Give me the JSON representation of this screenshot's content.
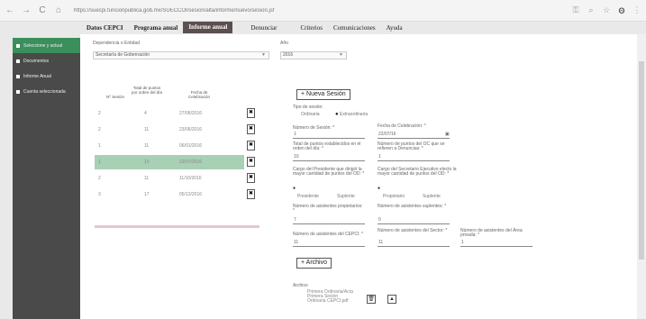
{
  "browser": {
    "back": "←",
    "forward": "→",
    "reload": "C",
    "home": "⌂",
    "url": "https://suecpi.funcionpublica.gob.mx/SUECCOI/sesion/alta/informe/nuevo/sesion.jsf",
    "icons": [
      "key-icon",
      "zoom-icon",
      "star-icon",
      "profile-icon",
      "menu-icon"
    ]
  },
  "sidebar": {
    "items": [
      {
        "label": "Seleccione y actual",
        "active": true
      },
      {
        "label": "Documentos",
        "active": false
      },
      {
        "label": "Informe Anual",
        "active": false
      },
      {
        "label": "Cuenta seleccionada",
        "active": false
      }
    ]
  },
  "menu": {
    "items": [
      {
        "label": "Datos CEPCI",
        "active": false
      },
      {
        "label": "Programa anual",
        "active": false
      },
      {
        "label": "Informe anual",
        "active": true
      },
      {
        "label": "Denunciar",
        "active": false
      },
      {
        "label": "Criterios",
        "active": false
      },
      {
        "label": "Comunicaciones",
        "active": false
      },
      {
        "label": "Ayuda",
        "active": false
      }
    ]
  },
  "filters": {
    "dependency_label": "Dependencia o Entidad",
    "dependency_value": "Secretaría de Gobernación",
    "year_label": "Año",
    "year_value": "2016"
  },
  "table": {
    "headers": [
      "Nº Sesión",
      "Total de puntos por orden del día",
      "Fecha de Celebración"
    ],
    "rows": [
      {
        "session": "2",
        "points": "4",
        "date": "27/06/2016",
        "selected": false
      },
      {
        "session": "2",
        "points": "11",
        "date": "23/06/2016",
        "selected": false
      },
      {
        "session": "1",
        "points": "11",
        "date": "06/01/2016",
        "selected": false
      },
      {
        "session": "1",
        "points": "10",
        "date": "22/07/2016",
        "selected": true
      },
      {
        "session": "2",
        "points": "11",
        "date": "11/10/2016",
        "selected": false
      },
      {
        "session": "3",
        "points": "17",
        "date": "05/12/2016",
        "selected": false
      }
    ],
    "delete_glyph": "✖"
  },
  "form": {
    "new_session_button": "+ Nueva Sesión",
    "session_type_label": "Tipo de sesión:",
    "session_type_options": [
      "Ordinaria",
      "Extraordinaria"
    ],
    "session_number_label": "Número de Sesión: *",
    "session_number_value": "1",
    "date_label": "Fecha de Celebración: *",
    "date_value": "22/07/16",
    "total_points_label": "Total de puntos establecidos en el orden del día: *",
    "total_points_value": "10",
    "cc_points_label": "Número de puntos del OC que se refieren a Denuncias: *",
    "cc_points_value": "1",
    "president_label": "Cargo del Presidente que dirigió la mayor cantidad de puntos del OD: *",
    "president_options": [
      "Presidente",
      "Suplente"
    ],
    "secretary_label": "Cargo del Secretario Ejecutivo electo la mayor cantidad de puntos del OD: *",
    "secretary_options": [
      "Propietario",
      "Suplente"
    ],
    "members_prop_label": "Número de asistentes propietarios: *",
    "members_prop_value": "7",
    "members_sup_label": "Número de asistentes suplentes: *",
    "members_sup_value": "0",
    "cepci_label": "Número de asistentes del CEPCI: *",
    "cepci_value": "11",
    "guests_label": "Número de asistentes del Sector: *",
    "guests_value": "11",
    "private_label": "Número de asistentes del Área privada: *",
    "private_value": "1",
    "archive_button": "+ Archivo",
    "archives_label": "Archivo",
    "file_name": "Primera Ordinaria/Acta Primera Sesión Ordinaria CEPCI.pdf",
    "file_delete": "🗑",
    "file_upload": "▲"
  }
}
